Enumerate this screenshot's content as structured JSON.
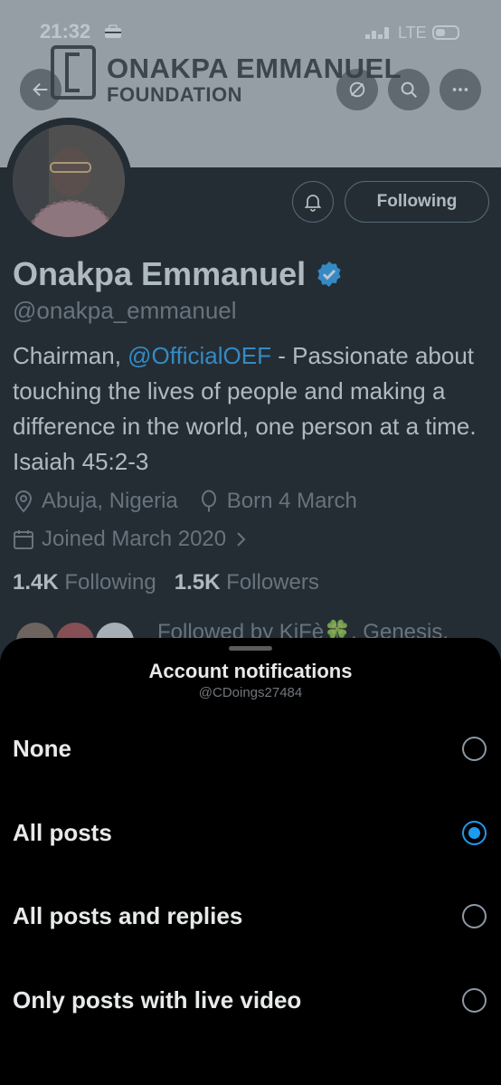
{
  "status_bar": {
    "time": "21:32",
    "network": "LTE"
  },
  "banner": {
    "title": "ONAKPA EMMANUEL",
    "subtitle": "FOUNDATION"
  },
  "profile": {
    "following_button": "Following",
    "name": "Onakpa Emmanuel",
    "handle": "@onakpa_emmanuel",
    "bio_prefix": "Chairman, ",
    "bio_mention": "@OfficialOEF",
    "bio_rest": " - Passionate about touching the lives of people and making a difference in the world, one person at a time. Isaiah 45:2-3",
    "location": "Abuja, Nigeria",
    "birthday": "Born 4 March",
    "joined": "Joined March 2020",
    "following_count": "1.4K",
    "following_label": "Following",
    "followers_count": "1.5K",
    "followers_label": "Followers",
    "followed_by": "Followed by KiFè🍀, Genesis,"
  },
  "sheet": {
    "title": "Account notifications",
    "subtitle": "@CDoings27484",
    "options": [
      {
        "label": "None",
        "selected": false
      },
      {
        "label": "All posts",
        "selected": true
      },
      {
        "label": "All posts and replies",
        "selected": false
      },
      {
        "label": "Only posts with live video",
        "selected": false
      }
    ]
  },
  "colors": {
    "accent": "#1d9bf0",
    "background": "#000000",
    "secondary_text": "#71767b"
  }
}
